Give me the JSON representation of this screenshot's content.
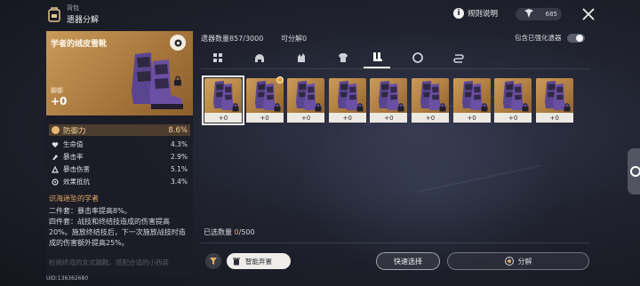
{
  "header": {
    "breadcrumb": "背包",
    "title": "遗器分解",
    "rules_label": "规则说明",
    "currency_value": "685"
  },
  "detail": {
    "name": "学者的绒皮雪靴",
    "slot": "脚部",
    "level": "+0",
    "main_stat": {
      "name": "防御力",
      "value": "8.6%"
    },
    "substats": [
      {
        "name": "生命值",
        "value": "4.3%",
        "icon": "heart-icon"
      },
      {
        "name": "暴击率",
        "value": "2.9%",
        "icon": "crit-rate-icon"
      },
      {
        "name": "暴击伤害",
        "value": "5.1%",
        "icon": "crit-dmg-icon"
      },
      {
        "name": "效果抵抗",
        "value": "3.4%",
        "icon": "effect-res-icon"
      }
    ],
    "set_name": "识海迷坠的学者",
    "set_2pc": "二件套：暴击率提高8%。",
    "set_4pc": "四件套：战技和终结技造成的伤害提高20%。施放终结技后，下一次施放战技时造成的伤害额外提高25%。",
    "set_faded": "检阅终适的女式翘靴，搭配合适的小西装"
  },
  "uid": "UID:136362680",
  "counts": {
    "relic_count": "遗器数量857/3000",
    "decompose_count": "可分解0"
  },
  "include_enhanced_label": "包含已强化遗器",
  "tabs": [
    {
      "name": "tab-all",
      "icon": "grid-icon"
    },
    {
      "name": "tab-head",
      "icon": "helmet-icon"
    },
    {
      "name": "tab-hands",
      "icon": "gloves-icon"
    },
    {
      "name": "tab-body",
      "icon": "armor-icon"
    },
    {
      "name": "tab-feet",
      "icon": "boots-icon",
      "active": true
    },
    {
      "name": "tab-sphere",
      "icon": "sphere-icon"
    },
    {
      "name": "tab-rope",
      "icon": "rope-icon"
    }
  ],
  "relics": [
    {
      "level": "+0",
      "selected": true
    },
    {
      "level": "+0",
      "marked": true
    },
    {
      "level": "+0"
    },
    {
      "level": "+0"
    },
    {
      "level": "+0"
    },
    {
      "level": "+0"
    },
    {
      "level": "+0"
    },
    {
      "level": "+0"
    },
    {
      "level": "+0"
    }
  ],
  "selection": {
    "label": "已选数量",
    "current": "0",
    "total": "/500"
  },
  "buttons": {
    "smart_discard": "智能弃置",
    "quick_select": "快速选择",
    "decompose": "分解"
  },
  "colors": {
    "accent_gold": "#e6ad64",
    "rarity_orange": "#c99a5a",
    "relic_purple": "#6b4fa3"
  }
}
